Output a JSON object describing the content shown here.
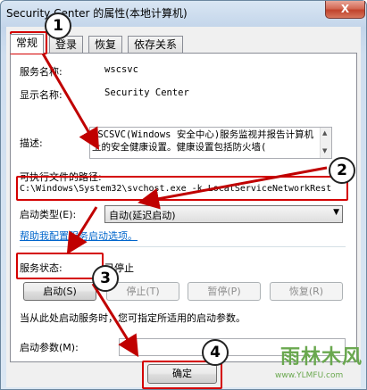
{
  "window": {
    "title": "Security Center 的属性(本地计算机)",
    "close_label": "X"
  },
  "tabs": [
    {
      "label": "常规",
      "active": true
    },
    {
      "label": "登录",
      "active": false
    },
    {
      "label": "恢复",
      "active": false
    },
    {
      "label": "依存关系",
      "active": false
    }
  ],
  "general": {
    "service_name_label": "服务名称:",
    "service_name": "wscsvc",
    "display_name_label": "显示名称:",
    "display_name": "Security Center",
    "description_label": "描述:",
    "description": "WSCSVC(Windows 安全中心)服务监视并报告计算机上的安全健康设置。健康设置包括防火墙(",
    "exe_path_label": "可执行文件的路径:",
    "exe_path": "C:\\Windows\\System32\\svchost.exe -k LocalServiceNetworkRest",
    "startup_type_label": "启动类型(E):",
    "startup_type_value": "自动(延迟启动)",
    "help_link": "帮助我配置服务启动选项。",
    "status_label": "服务状态:",
    "status_value": "已停止",
    "hint": "当从此处启动服务时，您可指定所适用的启动参数。",
    "params_label": "启动参数(M):",
    "params_value": ""
  },
  "buttons": {
    "start": "启动(S)",
    "stop": "停止(T)",
    "pause": "暂停(P)",
    "resume": "恢复(R)",
    "ok": "确定"
  },
  "annotations": {
    "step1": "1",
    "step2": "2",
    "step3": "3",
    "step4": "4",
    "color": "#d40000"
  },
  "watermark": {
    "text": "雨林木风",
    "url": "www.YLMFU.com"
  }
}
